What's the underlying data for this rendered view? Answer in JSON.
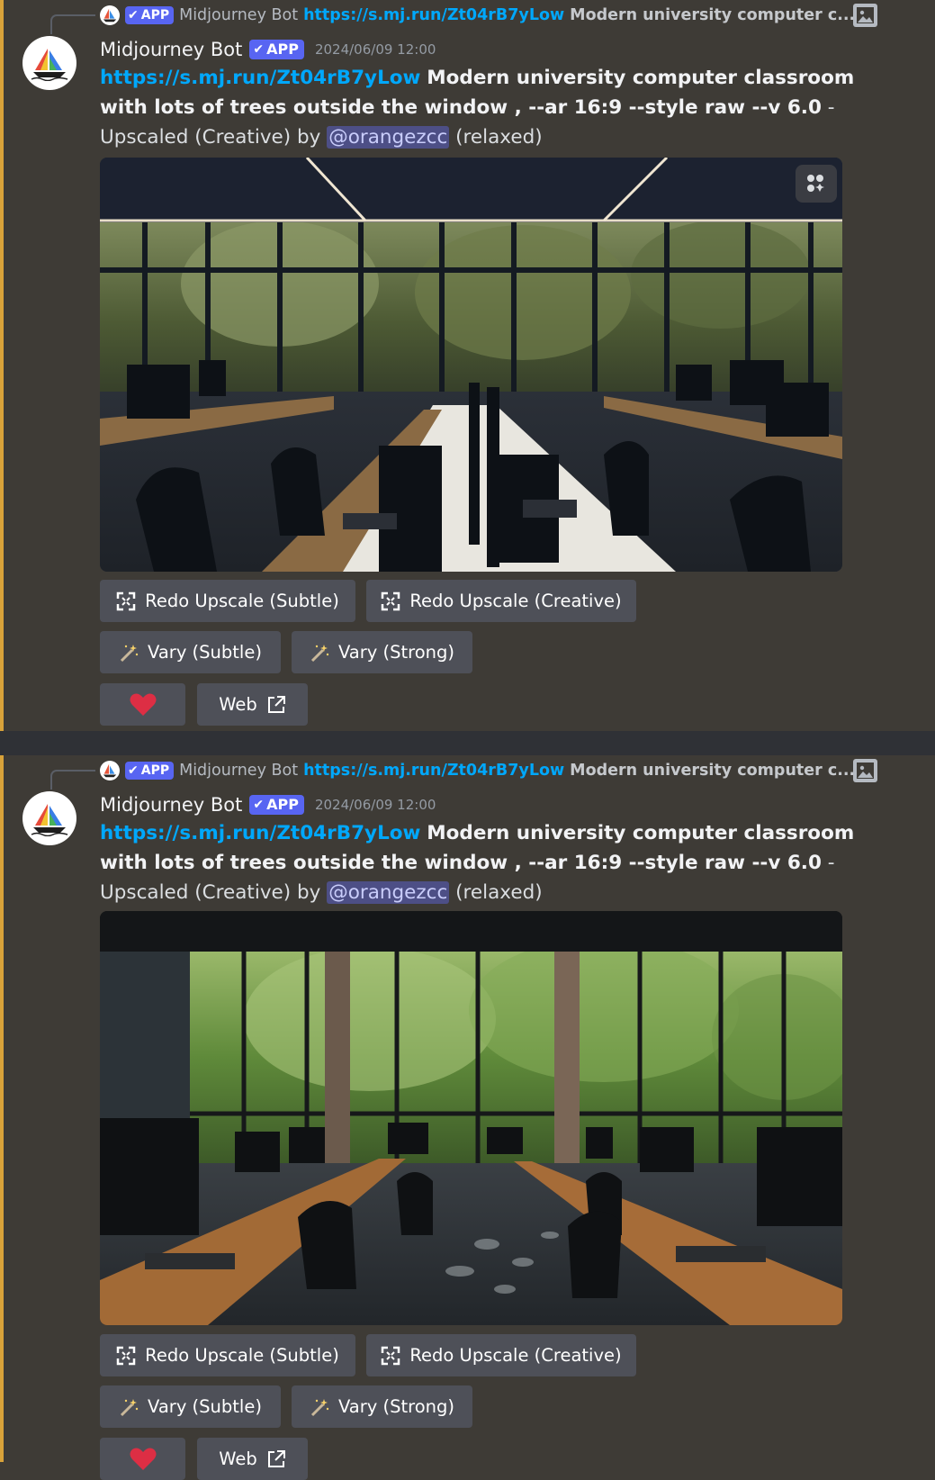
{
  "messages": [
    {
      "reply": {
        "tag": "APP",
        "name": "Midjourney Bot",
        "link": "https://s.mj.run/Zt04rB7yLow",
        "text": "Modern university computer c..."
      },
      "author": "Midjourney Bot",
      "tag": "APP",
      "timestamp": "2024/06/09 12:00",
      "link": "https://s.mj.run/Zt04rB7yLow",
      "prompt": "Modern university computer classroom with lots of trees outside the window , --ar 16:9 --style raw --v 6.0",
      "suffix": " - Upscaled (Creative) by ",
      "mention": "@orangezcc",
      "status": " (relaxed)",
      "buttons": {
        "redo_subtle": "Redo Upscale (Subtle)",
        "redo_creative": "Redo Upscale (Creative)",
        "vary_subtle": "Vary (Subtle)",
        "vary_strong": "Vary (Strong)",
        "web": "Web"
      }
    },
    {
      "reply": {
        "tag": "APP",
        "name": "Midjourney Bot",
        "link": "https://s.mj.run/Zt04rB7yLow",
        "text": "Modern university computer c..."
      },
      "author": "Midjourney Bot",
      "tag": "APP",
      "timestamp": "2024/06/09 12:00",
      "link": "https://s.mj.run/Zt04rB7yLow",
      "prompt": "Modern university computer classroom with lots of trees outside the window , --ar 16:9 --style raw --v 6.0",
      "suffix": " - Upscaled (Creative) by ",
      "mention": "@orangezcc",
      "status": " (relaxed)",
      "buttons": {
        "redo_subtle": "Redo Upscale (Subtle)",
        "redo_creative": "Redo Upscale (Creative)",
        "vary_subtle": "Vary (Subtle)",
        "vary_strong": "Vary (Strong)",
        "web": "Web"
      }
    }
  ],
  "colors": {
    "background": "#3e3b36",
    "highlight_bar": "#d8a23a",
    "link": "#00a8fc",
    "app_tag": "#5865f2",
    "button": "#4e5058",
    "heart": "#dd2e44"
  },
  "icons": [
    "sailboat-logo-icon",
    "checkmark-icon",
    "image-icon",
    "apps-icon",
    "expand-icon",
    "magic-wand-icon",
    "heart-icon",
    "external-link-icon"
  ]
}
